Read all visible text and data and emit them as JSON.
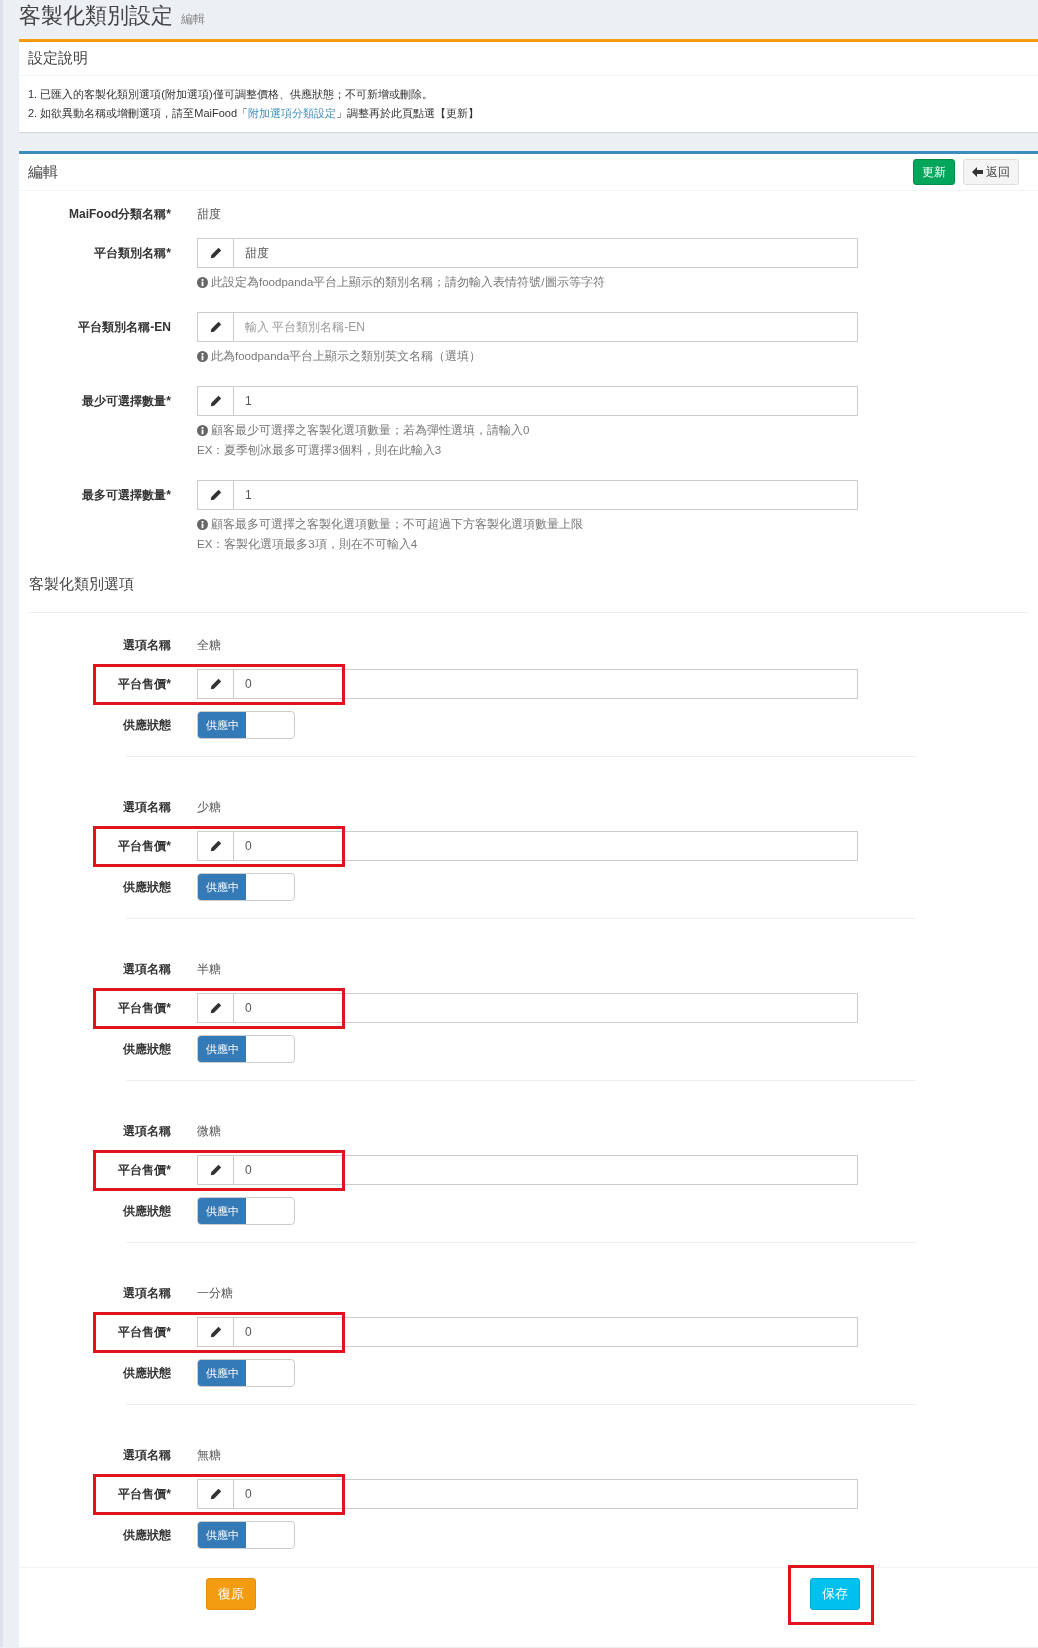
{
  "page": {
    "title": "客製化類別設定",
    "subtitle": "編輯"
  },
  "instructions": {
    "title": "設定說明",
    "lines": [
      {
        "text": "1. 已匯入的客製化類別選項(附加選項)僅可調整價格、供應狀態；不可新增或刪除。"
      },
      {
        "text": "2. 如欲異動名稱或增刪選項，請至MaiFood「",
        "link": "附加選項分類設定",
        "after": "」調整再於此頁點選【更新】"
      }
    ]
  },
  "edit": {
    "title": "編輯",
    "buttons": [
      {
        "label": "更新",
        "kind": "success"
      },
      {
        "label": "返回",
        "kind": "back"
      }
    ],
    "fields": [
      {
        "kind": "static",
        "label": "MaiFood分類名稱*",
        "value": "甜度"
      },
      {
        "kind": "input",
        "label": "平台類別名稱*",
        "value": "甜度",
        "help": "此設定為foodpanda平台上顯示的類別名稱；請勿輸入表情符號/圖示等字符"
      },
      {
        "kind": "input",
        "label": "平台類別名稱-EN",
        "placeholder": "輸入 平台類別名稱-EN",
        "help": "此為foodpanda平台上顯示之類別英文名稱（選填）"
      },
      {
        "kind": "input",
        "label": "最少可選擇數量*",
        "value": "1",
        "help": "顧客最少可選擇之客製化選項數量；若為彈性選填，請輸入0",
        "example": "EX：夏季刨冰最多可選擇3個料，則在此輸入3"
      },
      {
        "kind": "input",
        "label": "最多可選擇數量*",
        "value": "1",
        "help": "顧客最多可選擇之客製化選項數量；不可超過下方客製化選項數量上限",
        "example": "EX：客製化選項最多3項，則在不可輸入4"
      }
    ],
    "options_title": "客製化類別選項",
    "options": [
      {
        "name_label": "選項名稱",
        "name": "全糖",
        "price_label": "平台售價*",
        "price": "0",
        "highlighted": true,
        "status_label": "供應狀態",
        "status_text": "供應中",
        "on": true
      },
      {
        "name_label": "選項名稱",
        "name": "少糖",
        "price_label": "平台售價*",
        "price": "0",
        "highlighted": true,
        "status_label": "供應狀態",
        "status_text": "供應中",
        "on": true
      },
      {
        "name_label": "選項名稱",
        "name": "半糖",
        "price_label": "平台售價*",
        "price": "0",
        "highlighted": true,
        "status_label": "供應狀態",
        "status_text": "供應中",
        "on": true
      },
      {
        "name_label": "選項名稱",
        "name": "微糖",
        "price_label": "平台售價*",
        "price": "0",
        "highlighted": true,
        "status_label": "供應狀態",
        "status_text": "供應中",
        "on": true
      },
      {
        "name_label": "選項名稱",
        "name": "一分糖",
        "price_label": "平台售價*",
        "price": "0",
        "highlighted": true,
        "status_label": "供應狀態",
        "status_text": "供應中",
        "on": true
      },
      {
        "name_label": "選項名稱",
        "name": "無糖",
        "price_label": "平台售價*",
        "price": "0",
        "highlighted": true,
        "status_label": "供應狀態",
        "status_text": "供應中",
        "on": true
      }
    ],
    "footer_buttons": [
      {
        "label": "復原",
        "kind": "warning",
        "highlighted": false
      },
      {
        "label": "保存",
        "kind": "info",
        "highlighted": true
      }
    ]
  }
}
